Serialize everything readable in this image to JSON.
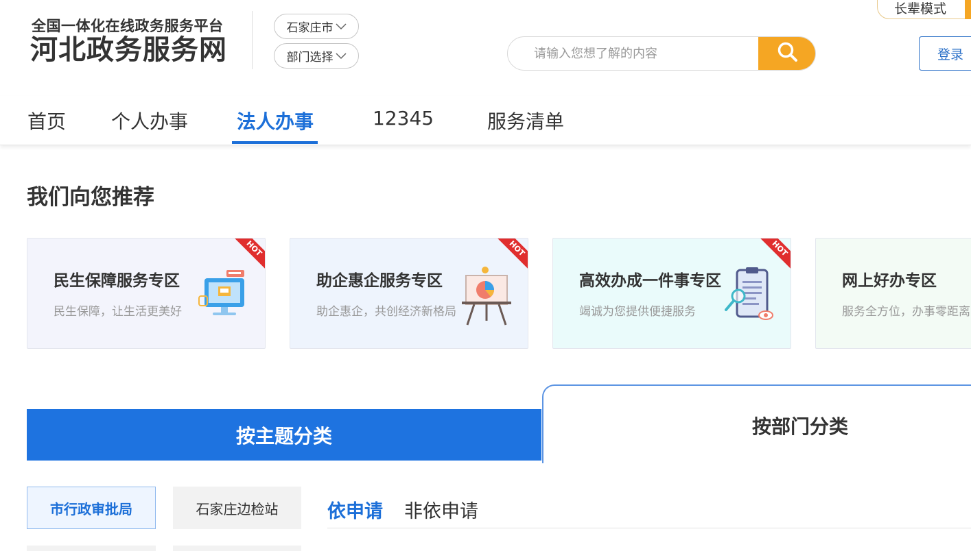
{
  "header": {
    "platform_subtitle": "全国一体化在线政务服务平台",
    "site_name": "河北政务服务网",
    "city_select": "石家庄市",
    "dept_select": "部门选择",
    "search_placeholder": "请输入您想了解的内容",
    "elder_mode": "长辈模式",
    "login": "登录"
  },
  "nav": {
    "items": [
      {
        "label": "首页"
      },
      {
        "label": "个人办事"
      },
      {
        "label": "法人办事"
      },
      {
        "label": "12345"
      },
      {
        "label": "服务清单"
      }
    ],
    "active_index": 2
  },
  "recommend": {
    "title": "我们向您推荐",
    "cards": [
      {
        "title": "民生保障服务专区",
        "desc": "民生保障，让生活更美好",
        "hot": "HOT",
        "bg": "#f3f4fc",
        "icon": "monitor-icon"
      },
      {
        "title": "助企惠企服务专区",
        "desc": "助企惠企，共创经济新格局",
        "hot": "HOT",
        "bg": "#eef4fd",
        "icon": "easel-chart-icon"
      },
      {
        "title": "高效办成一件事专区",
        "desc": "竭诚为您提供便捷服务",
        "hot": "HOT",
        "bg": "#eafbfb",
        "icon": "clipboard-magnifier-icon"
      },
      {
        "title": "网上好办专区",
        "desc": "服务全方位，办事零距离",
        "bg": "#f3fbf5"
      }
    ]
  },
  "category": {
    "theme_tab": "按主题分类",
    "dept_tab": "按部门分类"
  },
  "departments": {
    "items": [
      "市行政审批局",
      "石家庄边检站"
    ],
    "active_index": 0
  },
  "apply_tabs": {
    "items": [
      "依申请",
      "非依申请"
    ],
    "active_index": 0
  },
  "colors": {
    "brand_blue": "#1c6fd8",
    "accent_orange": "#f5a623",
    "hot_red": "#e02e2e"
  }
}
